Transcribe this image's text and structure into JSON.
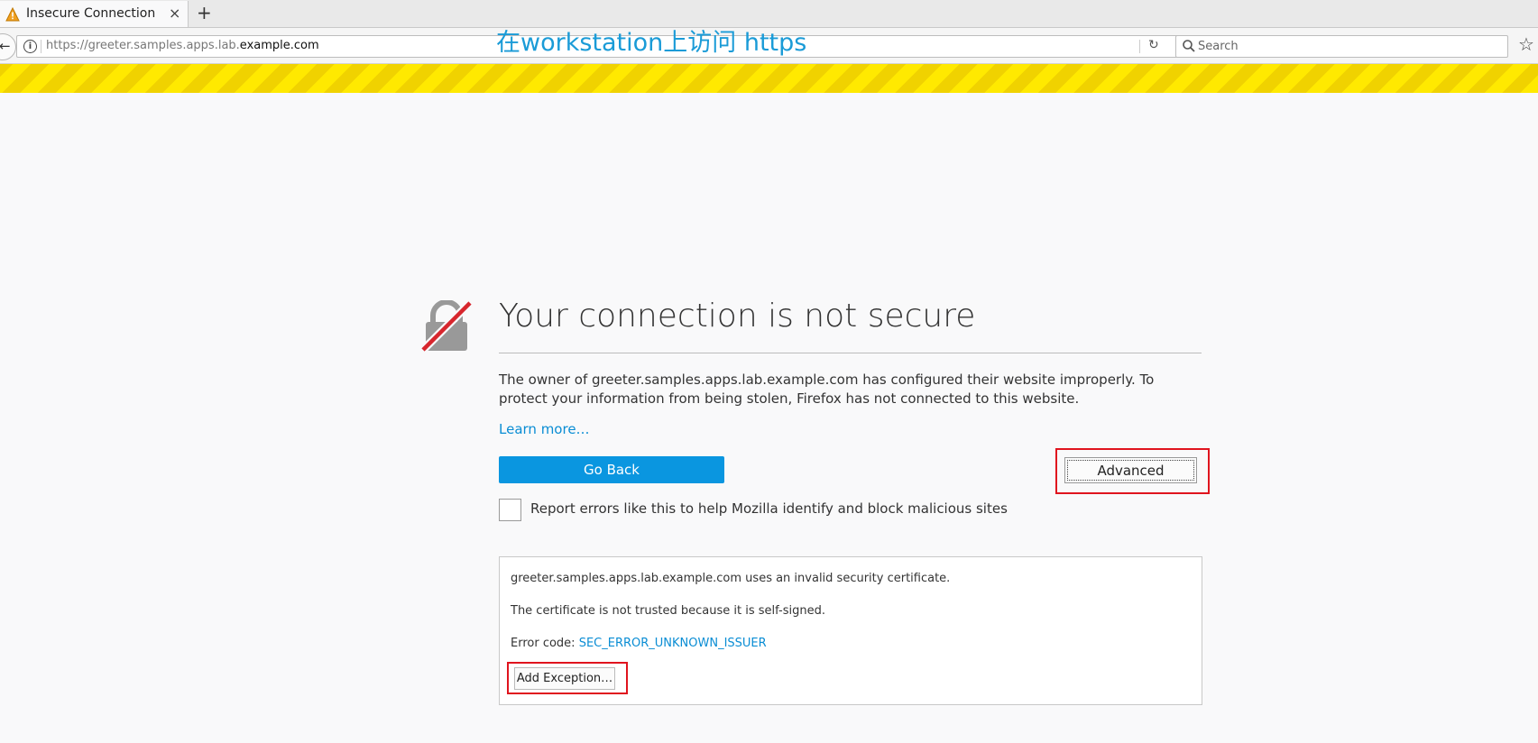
{
  "browser": {
    "tab": {
      "title": "Insecure Connection",
      "close_label": "×",
      "new_tab_label": "+"
    },
    "urlbar": {
      "url_prefix": "https://greeter.samples.apps.lab.",
      "url_domain": "example.com",
      "info_label": "i",
      "reload_label": "↻"
    },
    "search": {
      "placeholder": "Search"
    },
    "bookmark_label": "☆",
    "back_label": "←"
  },
  "annotation": {
    "overlay_text": "在workstation上访问 https"
  },
  "error_page": {
    "title": "Your connection is not secure",
    "description": "The owner of greeter.samples.apps.lab.example.com has configured their website improperly. To protect your information from being stolen, Firefox has not connected to this website.",
    "learn_more": "Learn more…",
    "go_back_label": "Go Back",
    "advanced_label": "Advanced",
    "report_label": "Report errors like this to help Mozilla identify and block malicious sites",
    "details": {
      "line1": "greeter.samples.apps.lab.example.com uses an invalid security certificate.",
      "line2": "The certificate is not trusted because it is self-signed.",
      "error_code_prefix": "Error code: ",
      "error_code": "SEC_ERROR_UNKNOWN_ISSUER",
      "add_exception_label": "Add Exception…"
    }
  },
  "colors": {
    "accent_blue": "#0a96e0",
    "link_blue": "#0a8dd4",
    "warning_yellow": "#ffe900",
    "highlight_red": "#e0141e"
  }
}
